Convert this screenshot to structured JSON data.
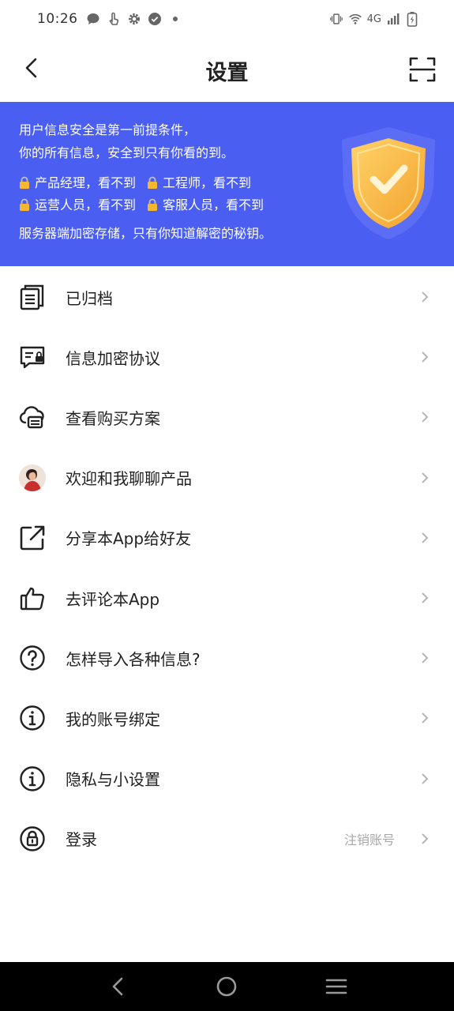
{
  "status_bar": {
    "time": "10:26",
    "network": "4G",
    "left_icons": [
      "chat-bubble-icon",
      "touch-icon",
      "gear-icon",
      "check-circle-icon",
      "dot-icon"
    ],
    "right_icons": [
      "vibrate-icon",
      "wifi-icon",
      "signal-icon",
      "battery-charging-icon"
    ]
  },
  "header": {
    "title": "设置",
    "back_icon": "chevron-left-icon",
    "scan_icon": "scan-icon"
  },
  "banner": {
    "background": "#4b5ef2",
    "line1": "用户信息安全是第一前提条件，",
    "line2": "你的所有信息，安全到只有你看的到。",
    "locks": [
      "产品经理，看不到",
      "工程师，看不到",
      "运营人员，看不到",
      "客服人员，看不到"
    ],
    "footer": "服务器端加密存储，只有你知道解密的秘钥。"
  },
  "settings": {
    "items": [
      {
        "label": "已归档",
        "icon": "archive-icon"
      },
      {
        "label": "信息加密协议",
        "icon": "encrypted-message-icon"
      },
      {
        "label": "查看购买方案",
        "icon": "cloud-plan-icon"
      },
      {
        "label": "欢迎和我聊聊产品",
        "icon": "avatar"
      },
      {
        "label": "分享本App给好友",
        "icon": "share-icon"
      },
      {
        "label": "去评论本App",
        "icon": "thumbs-up-icon"
      },
      {
        "label": "怎样导入各种信息?",
        "icon": "question-circle-icon"
      },
      {
        "label": "我的账号绑定",
        "icon": "info-circle-icon"
      },
      {
        "label": "隐私与小设置",
        "icon": "info-circle-icon"
      },
      {
        "label": "登录",
        "icon": "lock-circle-icon",
        "aside": "注销账号"
      }
    ]
  },
  "navbar": {
    "icons": [
      "nav-back-icon",
      "nav-home-icon",
      "nav-menu-icon"
    ]
  }
}
